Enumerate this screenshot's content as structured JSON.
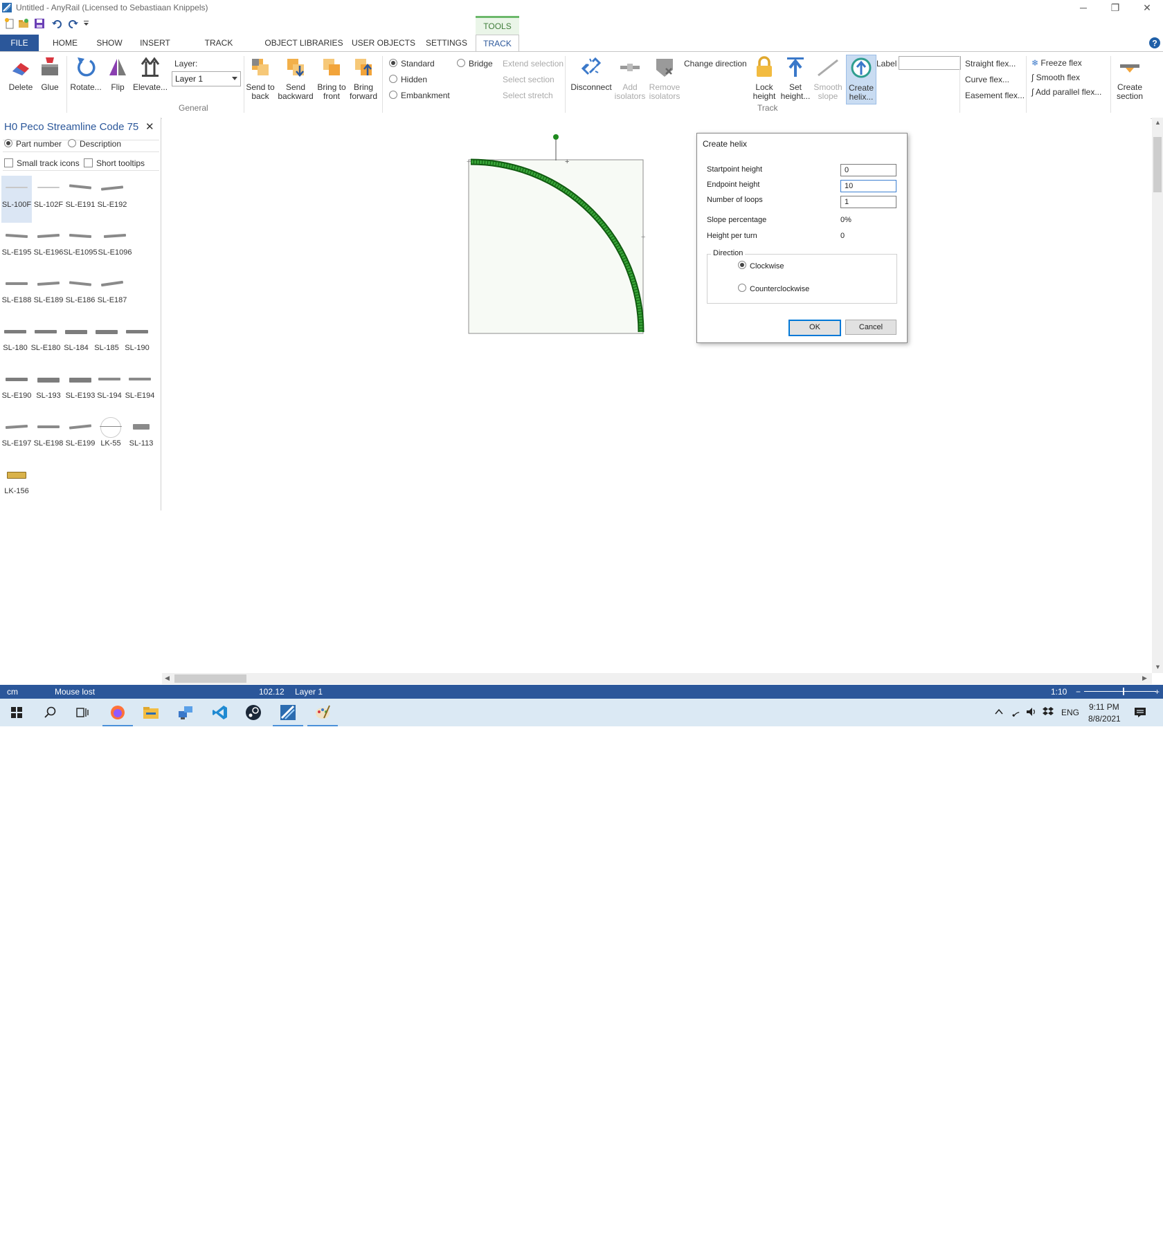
{
  "window": {
    "title": "Untitled - AnyRail (Licensed to Sebastiaan Knippels)"
  },
  "ribbon": {
    "tools_label": "TOOLS",
    "tabs": [
      "FILE",
      "HOME",
      "SHOW",
      "INSERT",
      "TRACK LIBRARIES",
      "OBJECT LIBRARIES",
      "USER OBJECTS",
      "SETTINGS",
      "TRACK"
    ],
    "general": {
      "delete": "Delete",
      "glue": "Glue",
      "rotate": "Rotate...",
      "flip": "Flip",
      "elevate": "Elevate...",
      "layer_label": "Layer:",
      "layer_value": "Layer 1",
      "group_label": "General"
    },
    "order": {
      "send_to_back_1": "Send to",
      "send_to_back_2": "back",
      "send_backward_1": "Send",
      "send_backward_2": "backward",
      "bring_to_front_1": "Bring to",
      "bring_to_front_2": "front",
      "bring_forward_1": "Bring",
      "bring_forward_2": "forward"
    },
    "track_type": {
      "standard": "Standard",
      "bridge": "Bridge",
      "hidden": "Hidden",
      "embankment": "Embankment"
    },
    "selection": {
      "extend": "Extend selection",
      "section": "Select section",
      "stretch": "Select stretch"
    },
    "track": {
      "disconnect": "Disconnect",
      "add_isolators_1": "Add",
      "add_isolators_2": "isolators",
      "remove_isolators_1": "Remove",
      "remove_isolators_2": "isolators",
      "change_direction": "Change direction",
      "lock_height_1": "Lock",
      "lock_height_2": "height",
      "set_height_1": "Set",
      "set_height_2": "height...",
      "smooth_slope_1": "Smooth",
      "smooth_slope_2": "slope",
      "create_helix_1": "Create",
      "create_helix_2": "helix...",
      "label": "Label",
      "label_value": "",
      "group_label": "Track"
    },
    "flex": {
      "straight": "Straight flex...",
      "curve": "Curve flex...",
      "easement": "Easement flex...",
      "freeze": "Freeze flex",
      "smooth": "Smooth flex",
      "add_parallel": "Add parallel flex..."
    },
    "section": {
      "create_1": "Create",
      "create_2": "section"
    }
  },
  "panel": {
    "title": "H0 Peco Streamline Code 75",
    "close": "✕",
    "part_number": "Part number",
    "description": "Description",
    "small_icons": "Small track icons",
    "short_tooltips": "Short tooltips",
    "parts": [
      "SL-100F",
      "SL-102F",
      "SL-E191",
      "SL-E192",
      "SL-E195",
      "SL-E196",
      "SL-E1095",
      "SL-E1096",
      "SL-E188",
      "SL-E189",
      "SL-E186",
      "SL-E187",
      "SL-180",
      "SL-E180",
      "SL-184",
      "SL-185",
      "SL-190",
      "SL-E190",
      "SL-193",
      "SL-E193",
      "SL-194",
      "SL-E194",
      "SL-E197",
      "SL-E198",
      "SL-E199",
      "LK-55",
      "SL-113",
      "LK-156"
    ]
  },
  "dialog": {
    "title": "Create helix",
    "startpoint_label": "Startpoint height",
    "startpoint_value": "0",
    "endpoint_label": "Endpoint height",
    "endpoint_value": "10",
    "loops_label": "Number of loops",
    "loops_value": "1",
    "slope_label": "Slope percentage",
    "slope_value": "0%",
    "height_turn_label": "Height per turn",
    "height_turn_value": "0",
    "direction_label": "Direction",
    "clockwise": "Clockwise",
    "counterclockwise": "Counterclockwise",
    "ok": "OK",
    "cancel": "Cancel"
  },
  "status": {
    "unit": "cm",
    "mouse": "Mouse lost",
    "coord": "102.12",
    "layer": "Layer 1",
    "zoom": "1:10",
    "zoom_minus": "−",
    "zoom_plus": "+"
  },
  "taskbar": {
    "lang": "ENG",
    "time": "9:11 PM",
    "date": "8/8/2021"
  },
  "colors": {
    "accent": "#2b579a",
    "track_green": "#1f8a1f",
    "tools_green": "#6bb86a"
  }
}
